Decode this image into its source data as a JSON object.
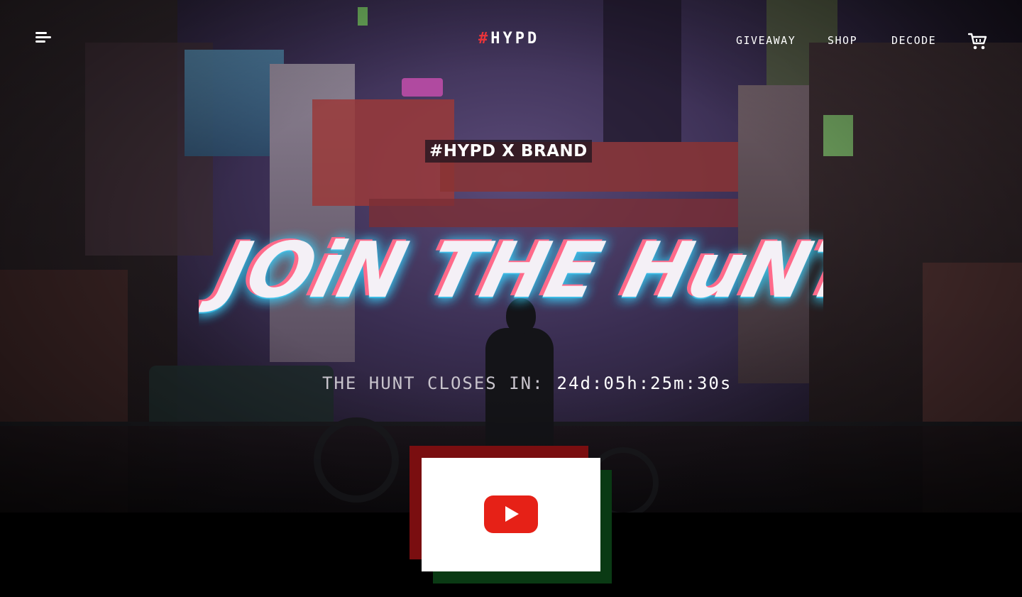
{
  "header": {
    "logo_hash": "#",
    "logo_text": "HYPD",
    "nav": {
      "giveaway": "GIVEAWAY",
      "shop": "SHOP",
      "decode": "DECODE"
    },
    "icons": {
      "menu": "menu-icon",
      "cart": "cart-icon"
    }
  },
  "hero": {
    "brand_tag": "#HYPD X BRAND",
    "headline": "JOiN THE HuNT",
    "countdown_label": "THE HUNT CLOSES IN:",
    "countdown_value": "24d:05h:25m:30s"
  },
  "video": {
    "play_icon": "youtube-play-icon"
  },
  "colors": {
    "accent_red": "#e8343a",
    "neon_cyan": "#3ad4ff",
    "neon_pink": "#ff6a8a",
    "youtube_red": "#e62117",
    "shadow_red": "#7a0e10",
    "shadow_green": "#0a3a14"
  }
}
